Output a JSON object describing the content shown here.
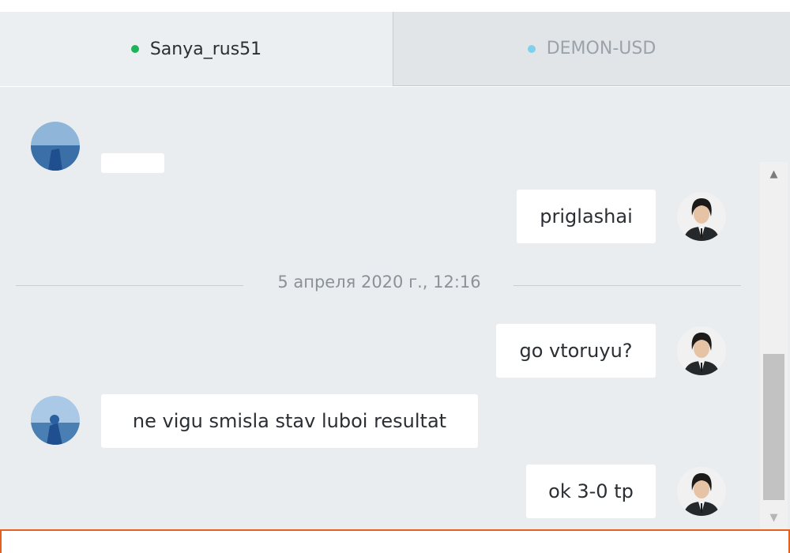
{
  "tabs": [
    {
      "label": "Sanya_rus51",
      "status_color": "#1cb35a",
      "active": true
    },
    {
      "label": "DEMON-USD",
      "status_color": "#7fd0ef",
      "active": false
    }
  ],
  "chat": {
    "messages": [
      {
        "from": "other",
        "text": ""
      },
      {
        "from": "self",
        "text": "priglashai"
      },
      {
        "type": "date",
        "text": "5 апреля 2020 г., 12:16"
      },
      {
        "from": "self",
        "text": "go vtoruyu?"
      },
      {
        "from": "other",
        "text": "ne vigu smisla stav luboi resultat"
      },
      {
        "from": "self",
        "text": "ok 3-0 tp"
      }
    ]
  },
  "icons": {
    "scroll_up": "triangle-up-icon",
    "scroll_down": "triangle-down-icon"
  }
}
